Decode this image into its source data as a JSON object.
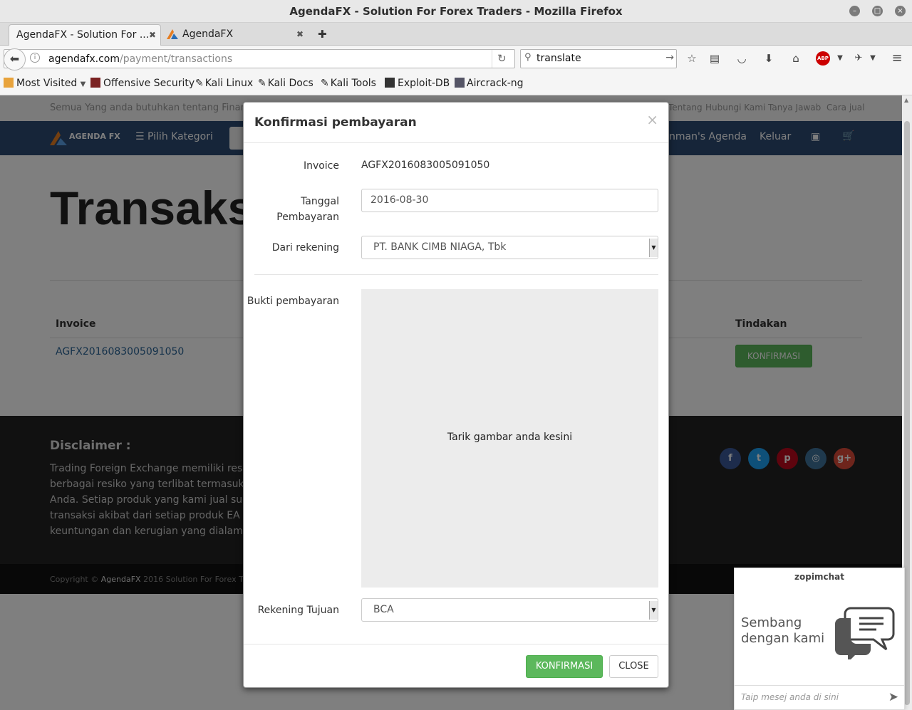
{
  "window": {
    "title": "AgendaFX - Solution For Forex Traders - Mozilla Firefox"
  },
  "tabs": [
    {
      "label": "AgendaFX - Solution For ..."
    },
    {
      "label": "AgendaFX"
    }
  ],
  "toolbar": {
    "url_domain": "agendafx.com",
    "url_path": "/payment/transactions",
    "search_value": "translate"
  },
  "bookmarks": [
    {
      "label": "Most Visited"
    },
    {
      "label": "Offensive Security"
    },
    {
      "label": "Kali Linux"
    },
    {
      "label": "Kali Docs"
    },
    {
      "label": "Kali Tools"
    },
    {
      "label": "Exploit-DB"
    },
    {
      "label": "Aircrack-ng"
    }
  ],
  "site": {
    "tagline": "Semua Yang anda butuhkan tentang Finansial",
    "top_links": [
      "Tentang",
      "Hubungi Kami",
      "Tanya Jawab",
      "Cara jual"
    ],
    "logo": "AGENDA FX",
    "category_menu": "Pilih Kategori",
    "user_menu": "nman's Agenda",
    "logout": "Keluar",
    "heading": "Transaks",
    "col_invoice": "Invoice",
    "col_action": "Tindakan",
    "row_invoice": "AGFX2016083005091050",
    "row_action": "KONFIRMASI",
    "disclaimer_title": "Disclaimer :",
    "disclaimer_lines": [
      "Trading Foreign Exchange memiliki resik",
      "berbagai resiko yang terlibat termasuk m",
      "Anda. Setiap produk yang kami jual sud",
      "transaksi akibat dari setiap produk EA & I",
      "keuntungan dan kerugian yang dialami ole"
    ],
    "copyright_prefix": "Copyright © ",
    "copyright_brand": "AgendaFX",
    "copyright_suffix": " 2016 Solution For Forex Traders"
  },
  "modal": {
    "title": "Konfirmasi pembayaran",
    "close_x": "×",
    "invoice_label": "Invoice",
    "invoice_value": "AGFX2016083005091050",
    "date_label_1": "Tanggal",
    "date_label_2": "Pembayaran",
    "date_value": "2016-08-30",
    "from_label": "Dari rekening",
    "from_value": "PT. BANK CIMB NIAGA, Tbk",
    "proof_label": "Bukti pembayaran",
    "dropzone_text": "Tarik gambar anda kesini",
    "to_label": "Rekening Tujuan",
    "to_value": "BCA",
    "confirm_button": "KONFIRMASI",
    "close_button": "CLOSE"
  },
  "chat": {
    "brand": "zopimchat",
    "message_line1": "Sembang",
    "message_line2": "dengan kami",
    "placeholder": "Taip mesej anda di sini"
  },
  "colors": {
    "nav_blue": "#2c4b73",
    "confirm_green": "#5cb85c",
    "link_blue": "#2a6496"
  }
}
